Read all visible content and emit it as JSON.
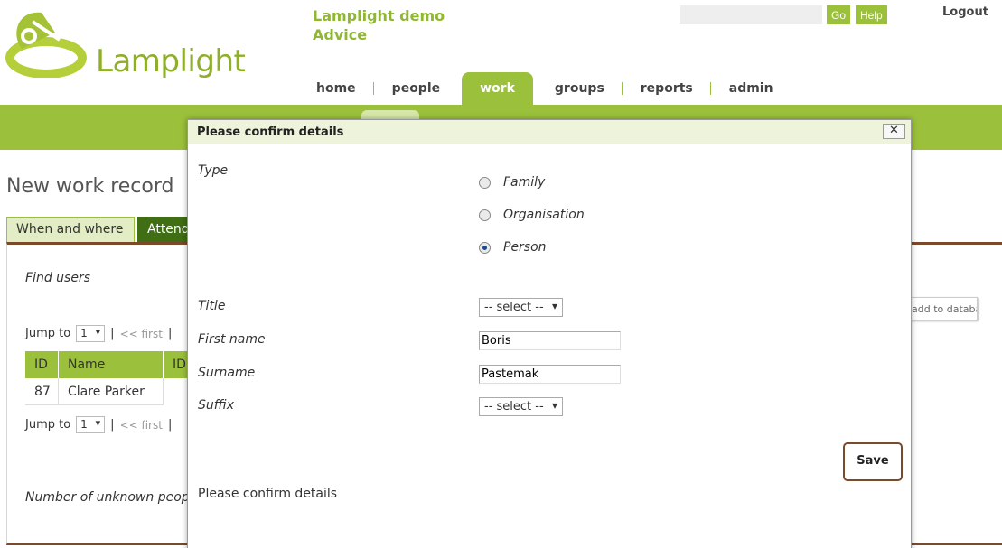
{
  "header": {
    "logo_text": "Lamplight",
    "org_line1": "Lamplight demo",
    "org_line2": "Advice",
    "search_placeholder": "",
    "go_label": "Go",
    "help_label": "Help",
    "logout_label": "Logout"
  },
  "nav": {
    "items": [
      {
        "label": "home"
      },
      {
        "label": "people"
      },
      {
        "label": "work",
        "active": true
      },
      {
        "label": "groups"
      },
      {
        "label": "reports"
      },
      {
        "label": "admin"
      }
    ]
  },
  "page": {
    "title": "New work record",
    "tabs": [
      {
        "label": "When and where"
      },
      {
        "label": "Attend"
      }
    ],
    "find_users_label": "Find users",
    "jump_label": "Jump to",
    "jump_value": "1",
    "pager_first": "<< first",
    "pager_sep": "|",
    "grid_headers": [
      "ID",
      "Name",
      "ID"
    ],
    "grid_rows": [
      {
        "id": "87",
        "name": "Clare Parker"
      }
    ],
    "unknown_label": "Number of unknown peop",
    "add_db_label": "add to database"
  },
  "dialog": {
    "title": "Please confirm details",
    "close_label": "✕",
    "type_label": "Type",
    "type_options": [
      {
        "label": "Family",
        "selected": false
      },
      {
        "label": "Organisation",
        "selected": false
      },
      {
        "label": "Person",
        "selected": true
      }
    ],
    "title_label": "Title",
    "title_value": "-- select --",
    "first_name_label": "First name",
    "first_name_value": "Boris",
    "surname_label": "Surname",
    "surname_value": "Pastemak",
    "suffix_label": "Suffix",
    "suffix_value": "-- select --",
    "save_label": "Save",
    "confirm_message": "Please confirm details"
  },
  "colors": {
    "brand_green": "#9bc03b",
    "dark_green": "#3f6e14",
    "accent_brown": "#7a4a2a"
  }
}
